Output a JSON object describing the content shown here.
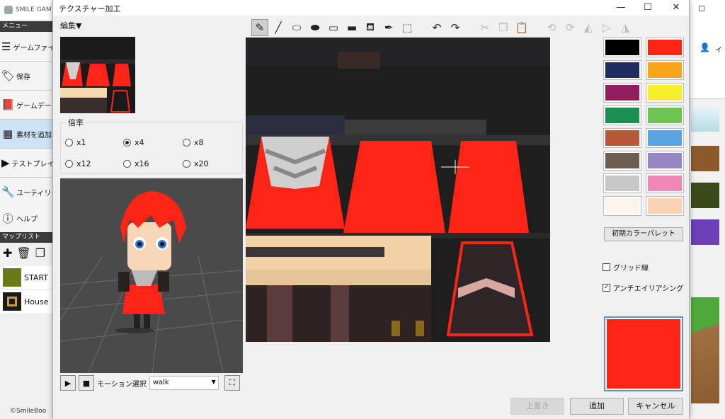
{
  "background_app": {
    "title": "SMILE GAM",
    "menu_header": "メニュー",
    "menu_items": [
      {
        "label": "ゲームファイ",
        "icon": "hamburger-icon"
      },
      {
        "label": "保存",
        "icon": "tag-icon"
      },
      {
        "label": "ゲームデー",
        "icon": "book-icon"
      },
      {
        "label": "素材を追加",
        "icon": "grid-icon"
      },
      {
        "label": "テストプレイ",
        "icon": "play-icon"
      },
      {
        "label": "ユーティリテ",
        "icon": "wrench-icon"
      },
      {
        "label": "ヘルプ",
        "icon": "info-icon"
      }
    ],
    "maplist_header": "マップリスト",
    "maps": [
      "START",
      "House"
    ],
    "footer": "©SmileBoo",
    "right_label": "イ"
  },
  "dialog": {
    "title": "テクスチャー加工",
    "edit_menu": "編集▼",
    "scale": {
      "legend": "倍率",
      "options": [
        "x1",
        "x4",
        "x8",
        "x12",
        "x16",
        "x20"
      ],
      "selected": "x4"
    },
    "motion": {
      "label": "モーション選択",
      "value": "walk"
    },
    "palette": [
      "#000000",
      "#ff2416",
      "#1f2b5e",
      "#f9a51a",
      "#8f1f5d",
      "#f7ee2c",
      "#1b8f52",
      "#6dc453",
      "#b55a39",
      "#5ba4e0",
      "#6c5d51",
      "#9786c1",
      "#c7c7c7",
      "#ef88b5",
      "#fdf5ec",
      "#fcd3b2"
    ],
    "reset_palette": "初期カラーパレット",
    "grid_label": "グリッド線",
    "grid_checked": false,
    "antialias_label": "アンチエイリアシング",
    "antialias_checked": true,
    "current_color": "#ff2416",
    "buttons": {
      "overwrite": "上書き",
      "add": "追加",
      "cancel": "キャンセル"
    }
  }
}
